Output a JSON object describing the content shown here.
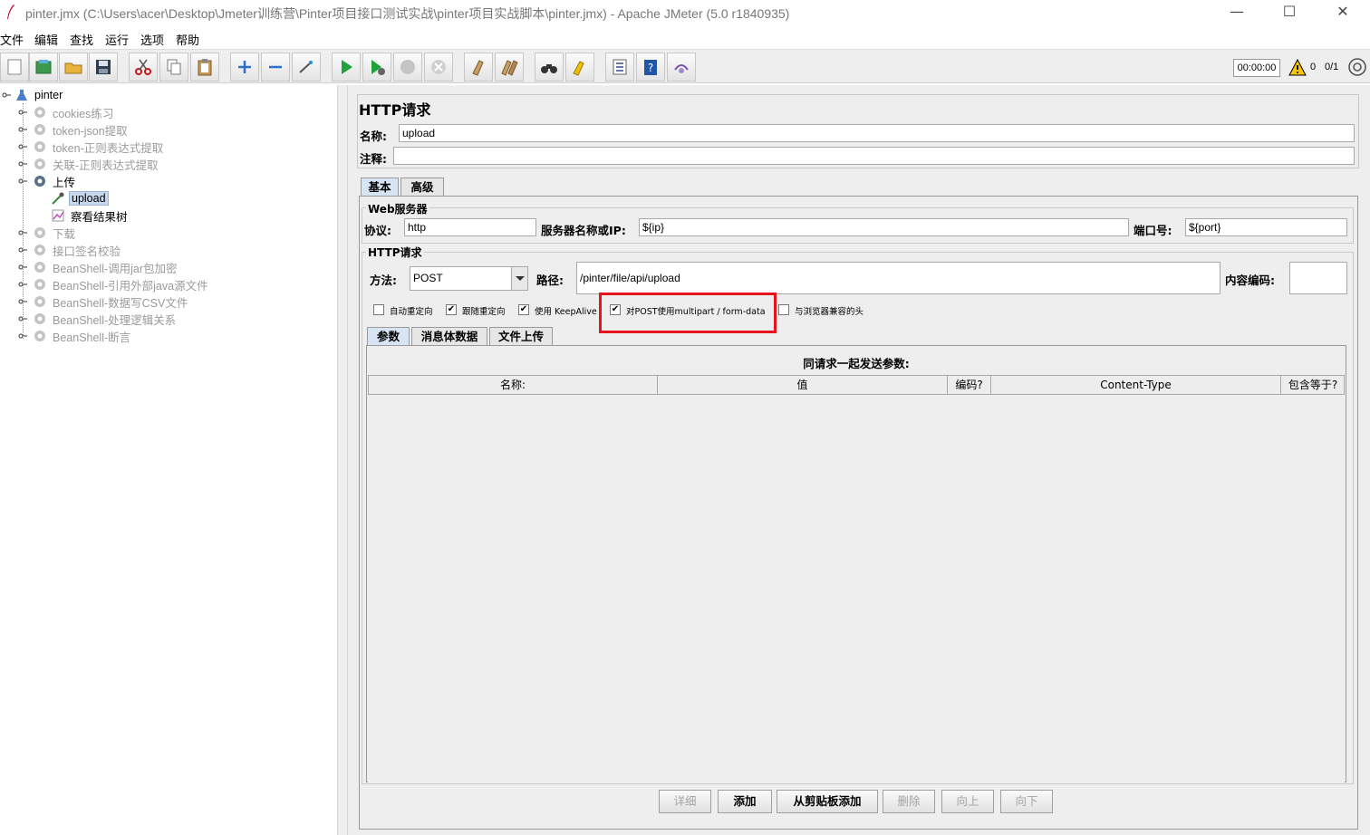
{
  "window": {
    "title": "pinter.jmx (C:\\Users\\acer\\Desktop\\Jmeter训练营\\Pinter项目接口测试实战\\pinter项目实战脚本\\pinter.jmx) - Apache JMeter (5.0 r1840935)",
    "minimize": "—",
    "maximize": "☐",
    "close": "✕"
  },
  "menu": [
    "文件",
    "编辑",
    "查找",
    "运行",
    "选项",
    "帮助"
  ],
  "status": {
    "timer": "00:00:00",
    "errors": "0",
    "threads": "0/1"
  },
  "tree": {
    "root": "pinter",
    "items": [
      {
        "label": "cookies练习",
        "disabled": true
      },
      {
        "label": "token-json提取",
        "disabled": true
      },
      {
        "label": "token-正则表达式提取",
        "disabled": true
      },
      {
        "label": "关联-正则表达式提取",
        "disabled": true
      },
      {
        "label": "上传",
        "disabled": false
      },
      {
        "label": "upload",
        "disabled": false,
        "selected": true
      },
      {
        "label": "察看结果树",
        "disabled": false
      },
      {
        "label": "下载",
        "disabled": true
      },
      {
        "label": "接口签名校验",
        "disabled": true
      },
      {
        "label": "BeanShell-调用jar包加密",
        "disabled": true
      },
      {
        "label": "BeanShell-引用外部java源文件",
        "disabled": true
      },
      {
        "label": "BeanShell-数据写CSV文件",
        "disabled": true
      },
      {
        "label": "BeanShell-处理逻辑关系",
        "disabled": true
      },
      {
        "label": "BeanShell-断言",
        "disabled": true
      }
    ]
  },
  "panel": {
    "title": "HTTP请求",
    "name_label": "名称:",
    "name_value": "upload",
    "comment_label": "注释:",
    "comment_value": "",
    "tabs": [
      "基本",
      "高级"
    ],
    "web_server": {
      "title": "Web服务器",
      "protocol_label": "协议:",
      "protocol_value": "http",
      "server_label": "服务器名称或IP:",
      "server_value": "${ip}",
      "port_label": "端口号:",
      "port_value": "${port}"
    },
    "http_request": {
      "title": "HTTP请求",
      "method_label": "方法:",
      "method_value": "POST",
      "path_label": "路径:",
      "path_value": "/pinter/file/api/upload",
      "encoding_label": "内容编码:",
      "encoding_value": ""
    },
    "options": [
      {
        "label": "自动重定向",
        "checked": false
      },
      {
        "label": "跟随重定向",
        "checked": true
      },
      {
        "label": "使用 KeepAlive",
        "checked": true
      },
      {
        "label": "对POST使用multipart / form-data",
        "checked": true
      },
      {
        "label": "与浏览器兼容的头",
        "checked": false
      }
    ],
    "sub_tabs": [
      "参数",
      "消息体数据",
      "文件上传"
    ],
    "params_title": "同请求一起发送参数:",
    "columns": [
      "名称:",
      "值",
      "编码?",
      "Content-Type",
      "包含等于?"
    ],
    "buttons": [
      "详细",
      "添加",
      "从剪贴板添加",
      "删除",
      "向上",
      "向下"
    ]
  },
  "colors": {
    "highlight": "#e8141c",
    "selected_tab": "#d7e4f4",
    "panel_bg": "#eeeeee"
  }
}
